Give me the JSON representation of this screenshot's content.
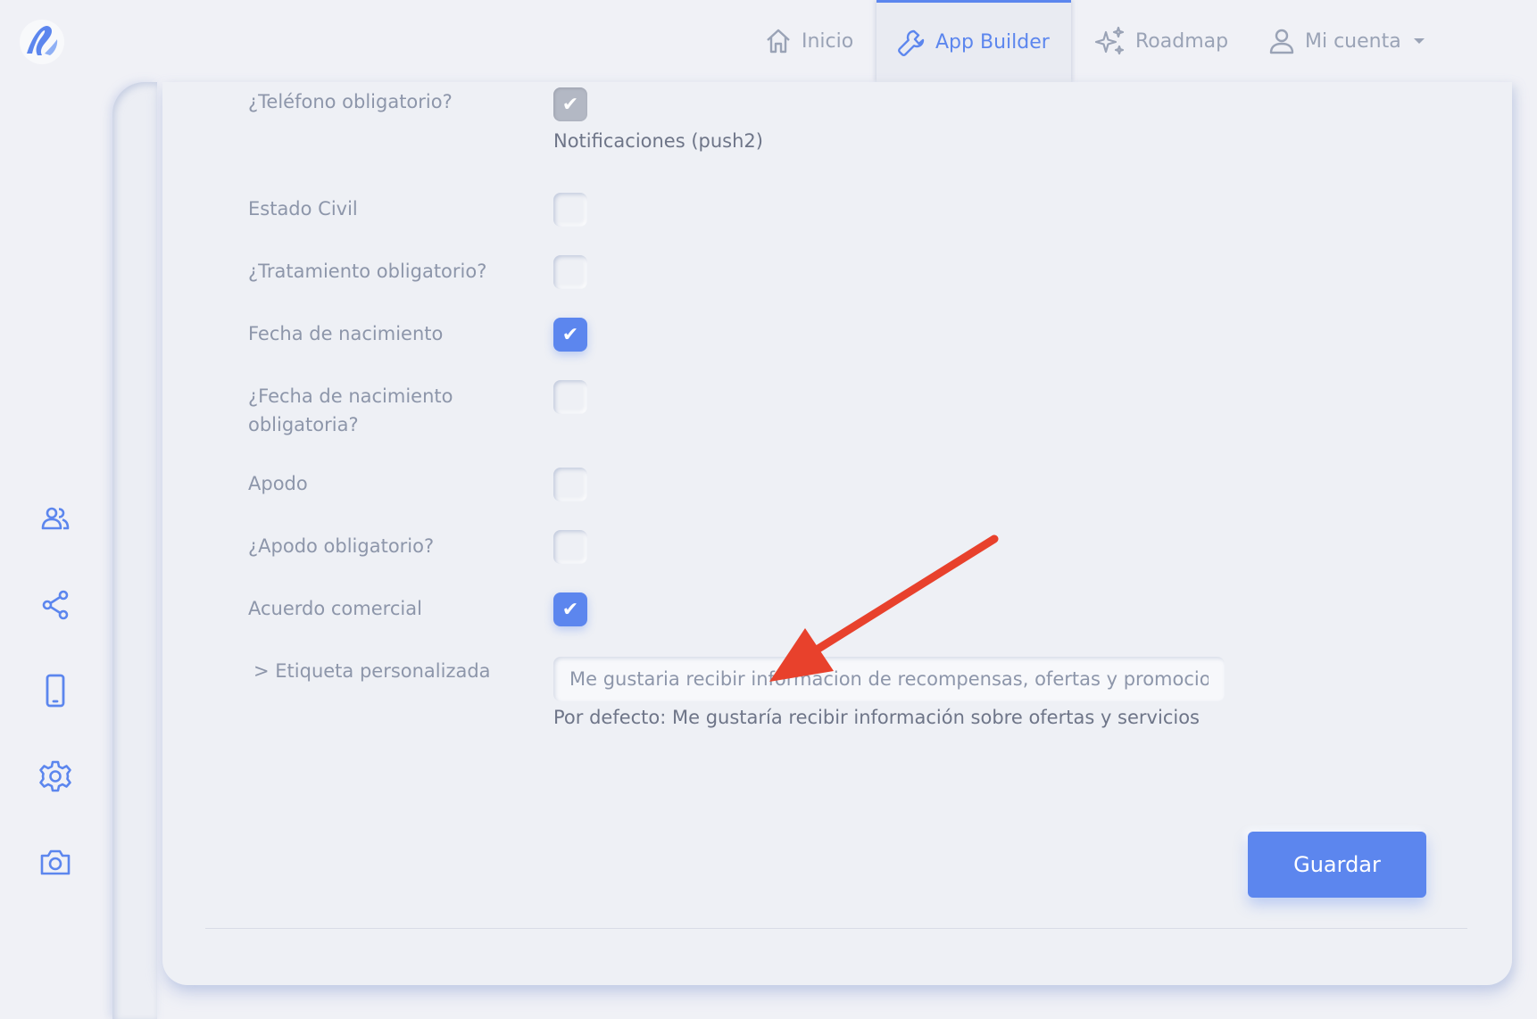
{
  "nav": {
    "inicio": "Inicio",
    "app_builder": "App Builder",
    "roadmap": "Roadmap",
    "mi_cuenta": "Mi cuenta"
  },
  "colors": {
    "accent": "#5c86ee",
    "background": "#f0f1f6",
    "annotation_arrow": "#e8412c"
  },
  "sidebar": {
    "icons": [
      "users-icon",
      "share-icon",
      "phone-icon",
      "gear-icon",
      "camera-icon"
    ]
  },
  "form": {
    "rows": [
      {
        "label": "¿Teléfono obligatorio?",
        "checked": true,
        "disabled": true
      },
      {
        "label": "Estado Civil",
        "checked": false
      },
      {
        "label": "¿Tratamiento obligatorio?",
        "checked": false
      },
      {
        "label": "Fecha de nacimiento",
        "checked": true
      },
      {
        "label": "¿Fecha de nacimiento obligatoria?",
        "checked": false
      },
      {
        "label": "Apodo",
        "checked": false
      },
      {
        "label": "¿Apodo obligatorio?",
        "checked": false
      },
      {
        "label": "Acuerdo comercial",
        "checked": true
      }
    ],
    "notificaciones_note": "Notificaciones (push2)",
    "custom_label": {
      "label": "> Etiqueta personalizada",
      "value": "Me gustaria recibir informacion de recompensas, ofertas y promocio",
      "default_hint": "Por defecto: Me gustaría recibir información sobre ofertas y servicios"
    },
    "check_glyph": "✔",
    "save_label": "Guardar"
  }
}
